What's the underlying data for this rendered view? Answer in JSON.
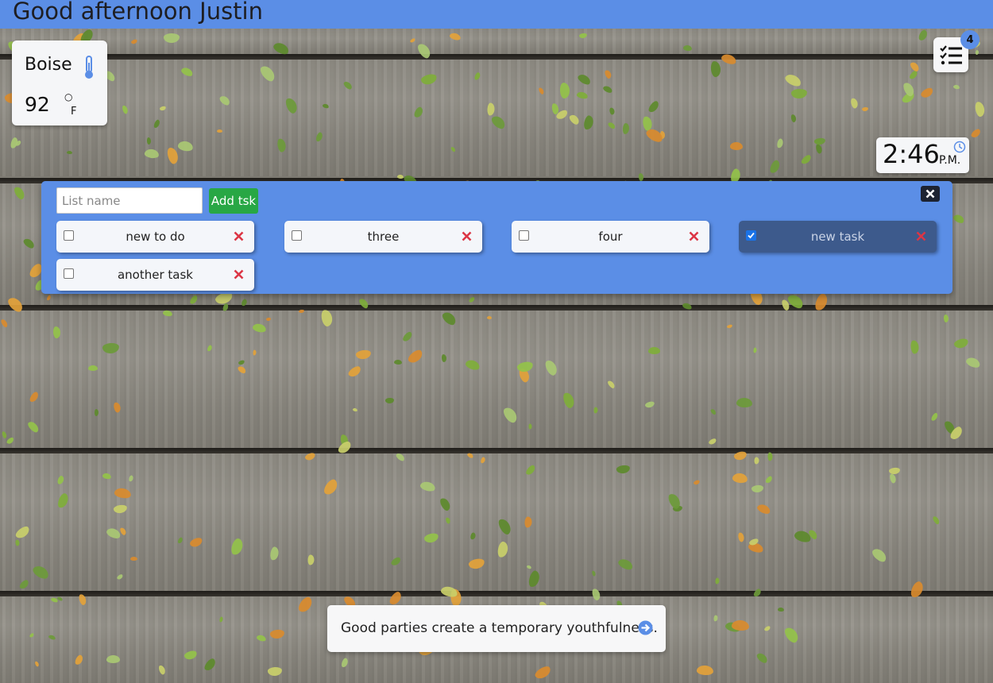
{
  "header": {
    "greeting": "Good afternoon Justin"
  },
  "weather": {
    "city": "Boise",
    "temperature": "92",
    "degree_symbol": "○",
    "unit": "F",
    "icon": "thermometer-icon"
  },
  "task_list_toggle": {
    "icon": "task-list-icon",
    "badge_count": "4"
  },
  "clock": {
    "time": "2:46",
    "period": "P.M.",
    "icon": "clock-icon"
  },
  "task_panel": {
    "input_placeholder": "List name",
    "input_value": "",
    "add_button_label": "Add tsk",
    "close_icon": "close-icon",
    "tasks": [
      {
        "label": "new to do",
        "checked": false
      },
      {
        "label": "three",
        "checked": false
      },
      {
        "label": "four",
        "checked": false
      },
      {
        "label": "new task",
        "checked": true
      },
      {
        "label": "another task",
        "checked": false
      }
    ]
  },
  "quote": {
    "text": "Good parties create a temporary youthfulness.",
    "icon": "arrow-right-circle-icon"
  },
  "colors": {
    "accent": "#5b8ee6",
    "add_button": "#28a745",
    "delete_icon": "#dc3545",
    "done_task_bg": "#3d5a8c"
  }
}
